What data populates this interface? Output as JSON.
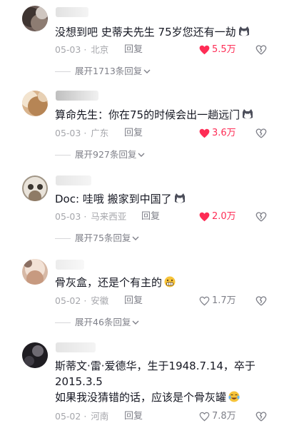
{
  "comments": [
    {
      "text": "没想到吧 史蒂夫先生 75岁您还有一劫",
      "date": "05-03",
      "location": "北京",
      "reply_label": "回复",
      "likes": "5.5万",
      "liked": true,
      "expand": "展开1713条回复",
      "emoji": "cat-emoji"
    },
    {
      "text": "算命先生：你在75的时候会出一趟远门",
      "date": "05-03",
      "location": "广东",
      "reply_label": "回复",
      "likes": "3.6万",
      "liked": true,
      "expand": "展开927条回复",
      "emoji": "cat-emoji"
    },
    {
      "text": "Doc: 哇哦 搬家到中国了",
      "date": "05-03",
      "location": "马来西亚",
      "reply_label": "回复",
      "likes": "2.0万",
      "liked": true,
      "expand": "展开75条回复",
      "emoji": "cat-emoji"
    },
    {
      "text": "骨灰盒，还是个有主的",
      "date": "05-02",
      "location": "安徽",
      "reply_label": "回复",
      "likes": "1.7万",
      "liked": false,
      "expand": "展开46条回复",
      "emoji": "grimace-emoji"
    },
    {
      "text_lines": [
        "斯蒂文·雷·爱德华，生于1948.7.14，卒于",
        "2015.3.5",
        "如果我没猜错的话，应该是个骨灰罐"
      ],
      "date": "05-02",
      "location": "河南",
      "reply_label": "回复",
      "likes": "7.8万",
      "liked": false,
      "emoji": "laugh-cry-emoji"
    }
  ],
  "separator": "·",
  "colors": {
    "liked": "#fe2c55",
    "meta": "#a5a6ab",
    "text": "#161823"
  }
}
